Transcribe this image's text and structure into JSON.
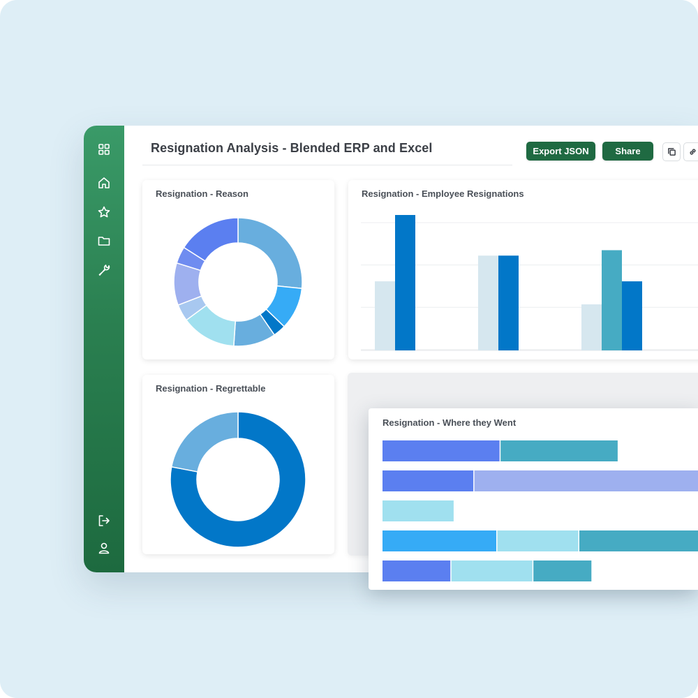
{
  "header": {
    "title": "Resignation Analysis - Blended ERP and Excel",
    "export_label": "Export JSON",
    "share_label": "Share"
  },
  "sidebar": {
    "top_items": [
      {
        "icon": "grid-icon"
      },
      {
        "icon": "home-icon"
      },
      {
        "icon": "star-icon"
      },
      {
        "icon": "folder-icon"
      },
      {
        "icon": "wrench-icon"
      }
    ],
    "bottom_items": [
      {
        "icon": "logout-icon"
      },
      {
        "icon": "user-icon"
      }
    ]
  },
  "colors": {
    "sidebar": "#2a7f50",
    "button": "#1f6a42",
    "dark_blue": "#0277c8",
    "light_blue": "#68aede",
    "teal": "#46abc3",
    "periwinkle": "#5b7ff0",
    "lavender": "#9eb0ef",
    "pale_cyan": "#a0e0ef"
  },
  "cards": {
    "reason": {
      "title": "Resignation - Reason"
    },
    "employee": {
      "title": "Resignation - Employee Resignations"
    },
    "regrettable": {
      "title": "Resignation - Regrettable"
    },
    "where": {
      "title": "Resignation - Where they Went"
    }
  },
  "chart_data": [
    {
      "id": "reason",
      "type": "pie",
      "donut": true,
      "slices": [
        {
          "value": 25,
          "color": "#68aede"
        },
        {
          "value": 10,
          "color": "#36abf6"
        },
        {
          "value": 3,
          "color": "#0277c8"
        },
        {
          "value": 10,
          "color": "#68aede"
        },
        {
          "value": 13,
          "color": "#a0e0ef"
        },
        {
          "value": 4,
          "color": "#a8c8f0"
        },
        {
          "value": 10,
          "color": "#9eb0ef"
        },
        {
          "value": 4,
          "color": "#6f8cf0"
        },
        {
          "value": 15,
          "color": "#5b7ff0"
        }
      ]
    },
    {
      "id": "employee",
      "type": "bar",
      "ylim": [
        0,
        100
      ],
      "grid": true,
      "series": [
        {
          "color": "#d6e7ef",
          "values": [
            51,
            70,
            34
          ]
        },
        {
          "color": "#46abc3",
          "values": [
            null,
            null,
            74
          ]
        },
        {
          "color": "#0277c8",
          "values": [
            100,
            70,
            51
          ]
        }
      ]
    },
    {
      "id": "regrettable",
      "type": "pie",
      "donut": true,
      "slices": [
        {
          "value": 78,
          "color": "#0277c8"
        },
        {
          "value": 22,
          "color": "#68aede"
        }
      ]
    },
    {
      "id": "where",
      "type": "bar",
      "stacked": true,
      "orientation": "horizontal",
      "xlim": [
        0,
        100
      ],
      "rows": [
        {
          "segments": [
            {
              "value": 36,
              "color": "#5b7ff0"
            },
            {
              "value": 36,
              "color": "#46abc3"
            }
          ]
        },
        {
          "segments": [
            {
              "value": 28,
              "color": "#5b7ff0"
            },
            {
              "value": 70,
              "color": "#9eb0ef"
            }
          ]
        },
        {
          "segments": [
            {
              "value": 22,
              "color": "#a0e0ef"
            }
          ]
        },
        {
          "segments": [
            {
              "value": 35,
              "color": "#36abf6"
            },
            {
              "value": 25,
              "color": "#a0e0ef"
            },
            {
              "value": 40,
              "color": "#46abc3"
            }
          ]
        },
        {
          "segments": [
            {
              "value": 21,
              "color": "#5b7ff0"
            },
            {
              "value": 25,
              "color": "#a0e0ef"
            },
            {
              "value": 18,
              "color": "#46abc3"
            }
          ]
        }
      ]
    }
  ]
}
